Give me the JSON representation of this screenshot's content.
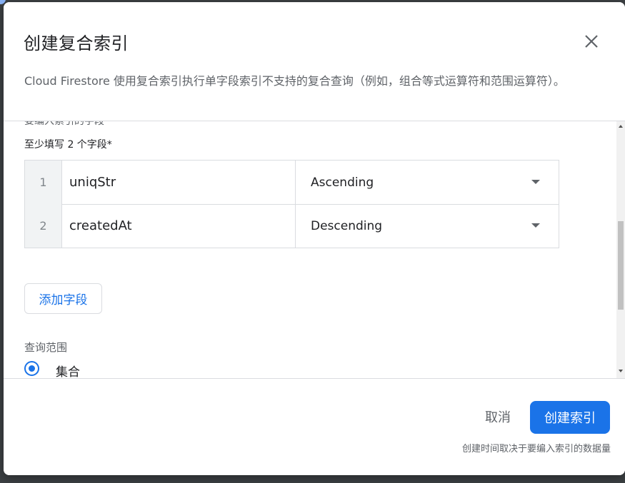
{
  "dialog": {
    "title": "创建复合索引",
    "description": "Cloud Firestore 使用复合索引执行单字段索引不支持的复合查询（例如，组合等式运算符和范围运算符）。"
  },
  "fields": {
    "cut_label": "要编入索引的字段",
    "subtitle": "至少填写 2 个字段*",
    "rows": [
      {
        "num": "1",
        "name": "uniqStr",
        "order": "Ascending"
      },
      {
        "num": "2",
        "name": "createdAt",
        "order": "Descending"
      }
    ],
    "add_button": "添加字段"
  },
  "scope": {
    "label": "查询范围",
    "option": "集合",
    "selected": true
  },
  "footer": {
    "cancel": "取消",
    "create": "创建索引",
    "note": "创建时间取决于要编入索引的数据量"
  },
  "colors": {
    "primary": "#1a73e8",
    "text": "#202124",
    "secondary_text": "#5f6368",
    "border": "#dadce0"
  },
  "icons": {
    "close": "close-icon",
    "dropdown": "chevron-down-icon",
    "radio": "radio-selected-icon"
  }
}
